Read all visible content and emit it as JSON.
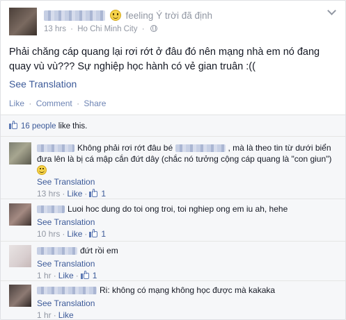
{
  "post": {
    "feeling_label": "feeling",
    "feeling_target": "Ý trời đã định",
    "timestamp": "13 hrs",
    "location": "Ho Chi Minh City",
    "body": "Phải chăng cáp quang lại rơi rớt ở đâu đó nên mạng nhà em nó đang quay vù vù??? Sự nghiệp học hành có vẻ gian truân :((",
    "see_translation": "See Translation",
    "actions": {
      "like": "Like",
      "comment": "Comment",
      "share": "Share"
    }
  },
  "likes": {
    "count": "16 people",
    "suffix": "like this."
  },
  "comments": [
    {
      "text_a": "Không phải rơi rớt đâu bé",
      "text_b": ", mà là theo tin từ dưới biển đưa lên là bị cá mập cắn đứt dây (chắc nó tưởng cộng cáp quang là \"con giun\")",
      "see_translation": "See Translation",
      "time": "13 hrs",
      "like": "Like",
      "like_count": "1"
    },
    {
      "text_a": "Luoi hoc dung do toi ong troi, toi nghiep ong em iu ah, hehe",
      "see_translation": "See Translation",
      "time": "10 hrs",
      "like": "Like",
      "like_count": "1"
    },
    {
      "text_a": "đứt rồi em",
      "see_translation": "See Translation",
      "time": "1 hr",
      "like": "Like",
      "like_count": "1"
    },
    {
      "text_a": "Ri: không có mạng không học được mà kakaka",
      "see_translation": "See Translation",
      "time": "1 hr",
      "like": "Like"
    }
  ],
  "icons": {
    "feeling": "smile-emoji-icon",
    "privacy": "globe-icon",
    "menu": "chevron-down-icon",
    "like": "thumbs-up-icon"
  }
}
